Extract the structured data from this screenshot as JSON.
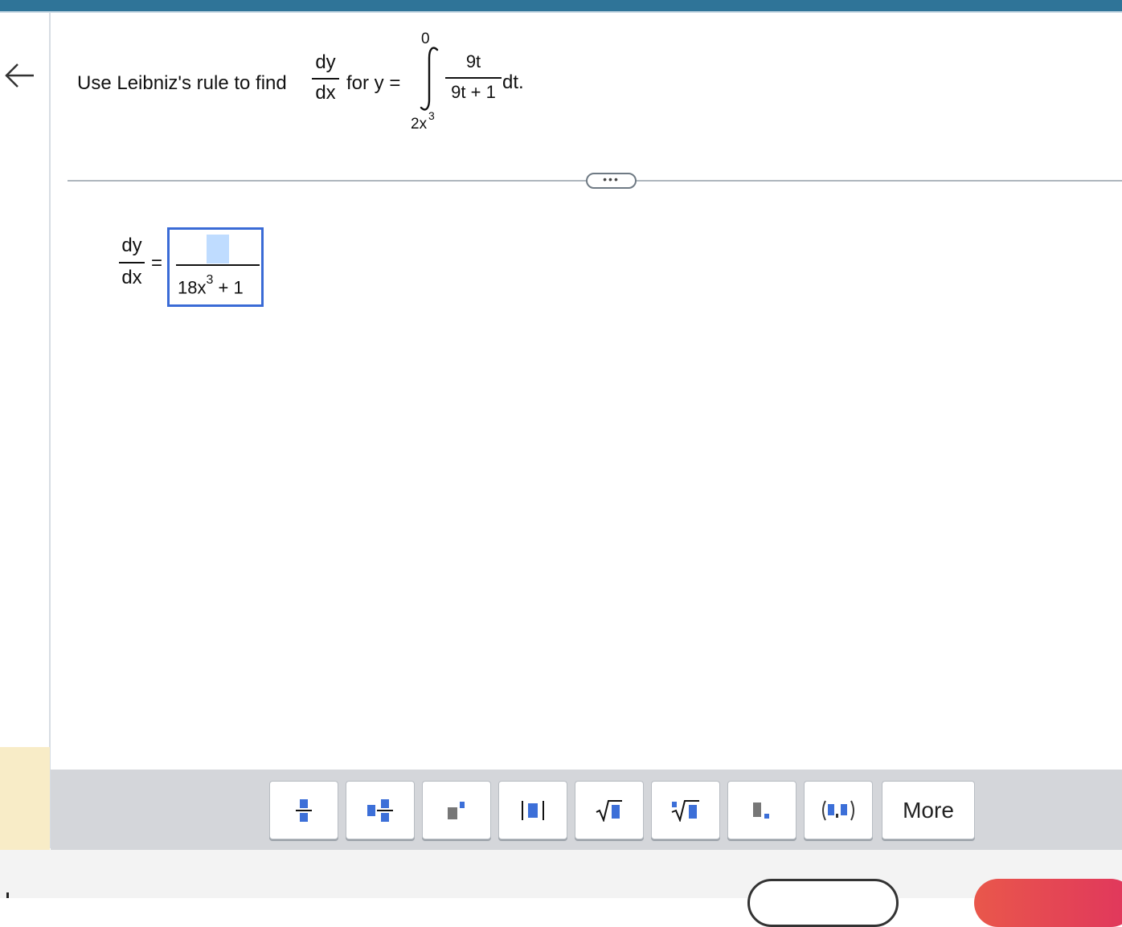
{
  "question": {
    "prefix": "Use Leibniz's rule to find",
    "deriv_num": "dy",
    "deriv_den": "dx",
    "for_text": "for y =",
    "upper_limit": "0",
    "lower_limit_base": "2x",
    "lower_limit_exp": "3",
    "integrand_num": "9t",
    "integrand_den": "9t + 1",
    "differential": "dt."
  },
  "divider": {
    "more_label": "•••"
  },
  "answer": {
    "lhs_num": "dy",
    "lhs_den": "dx",
    "equals": "=",
    "den_base": "18x",
    "den_exp": "3",
    "den_rest": " + 1"
  },
  "toolbar": {
    "buttons": [
      {
        "name": "fraction-button",
        "icon": "fraction-icon"
      },
      {
        "name": "mixed-number-button",
        "icon": "mixed-fraction-icon"
      },
      {
        "name": "exponent-button",
        "icon": "superscript-icon"
      },
      {
        "name": "absolute-value-button",
        "icon": "absolute-value-icon"
      },
      {
        "name": "square-root-button",
        "icon": "sqrt-icon"
      },
      {
        "name": "nth-root-button",
        "icon": "nth-root-icon"
      },
      {
        "name": "decimal-button",
        "icon": "decimal-icon"
      },
      {
        "name": "ordered-pair-button",
        "icon": "ordered-pair-icon"
      }
    ],
    "more_label": "More"
  },
  "colors": {
    "topbar": "#2f7498",
    "input_border": "#3a6bd6",
    "icon_blue": "#3c6fd8",
    "toolbar_bg": "#d4d6da",
    "sidebar_highlight": "#f8ecc7"
  }
}
